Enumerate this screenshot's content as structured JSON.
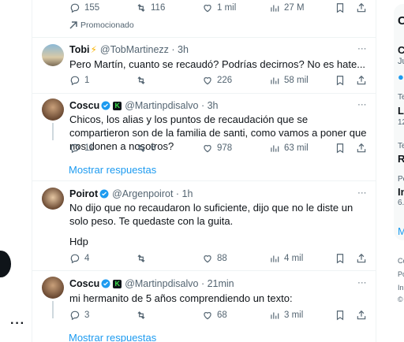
{
  "top_tweet": {
    "replies": "155",
    "retweets": "116",
    "likes": "1 mil",
    "views": "27 M",
    "promoted_label": "Promocionado"
  },
  "tweets": [
    {
      "name": "Tobi",
      "handle": "@TobMartinezz · 3h",
      "text": "Pero Martín, cuanto se recaudó? Podrías decirnos? No es hate...",
      "replies": "1",
      "retweets": "",
      "likes": "226",
      "views": "58 mil"
    },
    {
      "name": "Coscu",
      "handle": "@Martinpdisalvo · 3h",
      "text": "Chicos, los alias y los puntos de recaudación que se compartieron son de la familia de santi, como vamos a poner que nos donen a nosotros?",
      "replies": "11",
      "retweets": "6",
      "likes": "978",
      "views": "63 mil",
      "more": "Mostrar respuestas"
    },
    {
      "name": "Poirot",
      "handle": "@Argenpoirot · 1h",
      "text": "No dijo que no recaudaron lo suficiente, dijo que no le diste un solo peso. Te quedaste con la guita.",
      "text2": "Hdp",
      "replies": "4",
      "retweets": "",
      "likes": "88",
      "views": "4 mil"
    },
    {
      "name": "Coscu",
      "handle": "@Martinpdisalvo · 21min",
      "text": "mi hermanito de 5 años comprendiendo un texto:",
      "replies": "3",
      "retweets": "",
      "likes": "68",
      "views": "3 mil",
      "more": "Mostrar respuestas"
    }
  ],
  "sidebar_fragments": {
    "a": "C",
    "b": "C",
    "c": "Ju",
    "d": "Te",
    "e": "Lo",
    "f": "12",
    "g": "Te",
    "h": "R",
    "i": "Po",
    "j": "In",
    "k": "6.",
    "l": "M",
    "m": "Co",
    "n": "Po",
    "o": "In",
    "p": "©",
    "left_dots": "···"
  },
  "colors": {
    "accent": "#1d9bf0",
    "text": "#0f1419",
    "muted": "#536471",
    "verified": "#1d9bf0"
  }
}
